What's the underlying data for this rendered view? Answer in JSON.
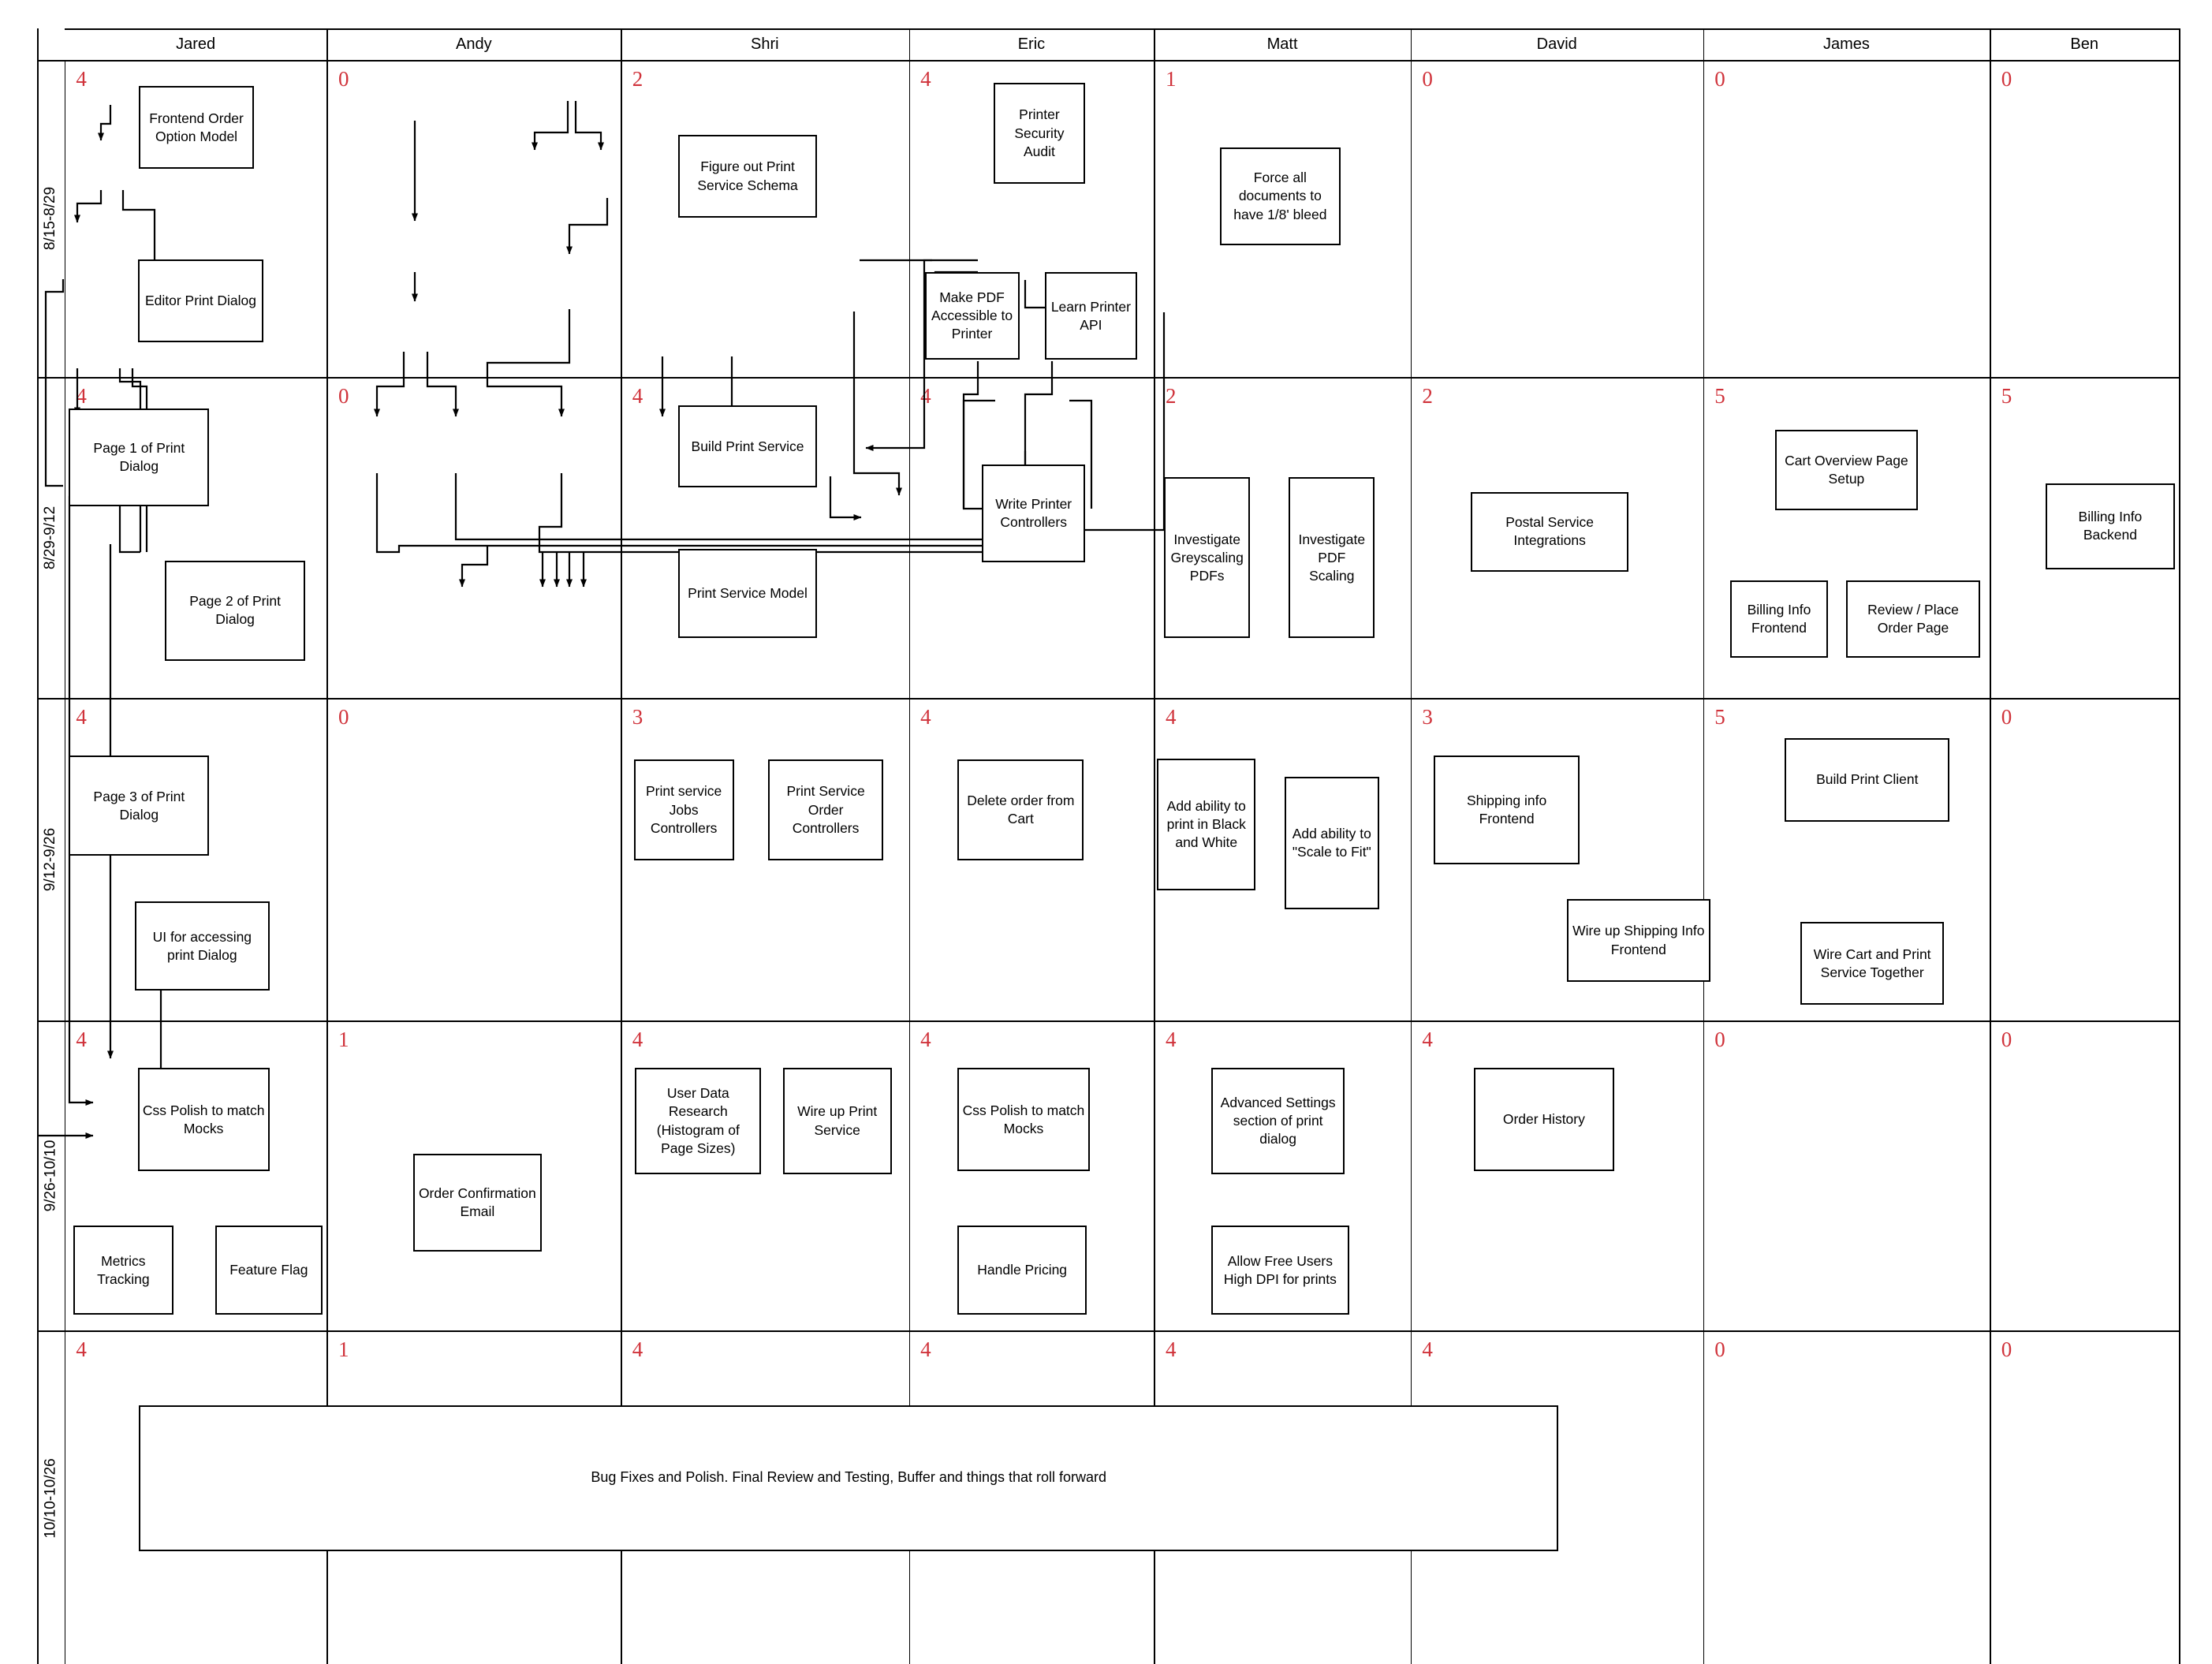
{
  "diagram": {
    "type": "sprint-swimlane-board",
    "columns": [
      {
        "name": "Jared"
      },
      {
        "name": "Andy"
      },
      {
        "name": "Shri"
      },
      {
        "name": "Eric"
      },
      {
        "name": "Matt"
      },
      {
        "name": "David"
      },
      {
        "name": "James"
      },
      {
        "name": "Ben"
      }
    ],
    "rows": [
      {
        "label": "8/15-8/29"
      },
      {
        "label": "8/29-9/12"
      },
      {
        "label": "9/12-9/26"
      },
      {
        "label": "9/26-10/10"
      },
      {
        "label": "10/10-10/26"
      }
    ],
    "counts": [
      [
        "4",
        "0",
        "2",
        "4",
        "1",
        "0",
        "0",
        "0"
      ],
      [
        "4",
        "0",
        "4",
        "4",
        "2",
        "2",
        "5",
        "5"
      ],
      [
        "4",
        "0",
        "3",
        "4",
        "4",
        "3",
        "5",
        "0"
      ],
      [
        "4",
        "1",
        "4",
        "4",
        "4",
        "4",
        "0",
        "0"
      ],
      [
        "4",
        "1",
        "4",
        "4",
        "4",
        "4",
        "0",
        "0"
      ]
    ],
    "count_color": "#d0333b",
    "nodes": [
      {
        "id": "frontend-order-option-model",
        "label": "Frontend Order Option Model"
      },
      {
        "id": "editor-print-dialog",
        "label": "Editor Print Dialog"
      },
      {
        "id": "figure-out-print-service-schema",
        "label": "Figure out Print Service Schema"
      },
      {
        "id": "printer-security-audit",
        "label": "Printer Security Audit"
      },
      {
        "id": "make-pdf-accessible-to-printer",
        "label": "Make PDF Accessible to Printer"
      },
      {
        "id": "learn-printer-api",
        "label": "Learn Printer API"
      },
      {
        "id": "force-all-documents-bleed",
        "label": "Force all documents to have 1/8' bleed"
      },
      {
        "id": "page-1-of-print-dialog",
        "label": "Page 1 of Print Dialog"
      },
      {
        "id": "page-2-of-print-dialog",
        "label": "Page 2 of Print Dialog"
      },
      {
        "id": "build-print-service",
        "label": "Build Print Service"
      },
      {
        "id": "print-service-model",
        "label": "Print Service Model"
      },
      {
        "id": "write-printer-controllers",
        "label": "Write Printer Controllers"
      },
      {
        "id": "investigate-greyscaling-pdfs",
        "label": "Investigate Greyscaling PDFs"
      },
      {
        "id": "investigate-pdf-scaling",
        "label": "Investigate PDF Scaling"
      },
      {
        "id": "postal-service-integrations",
        "label": "Postal Service Integrations"
      },
      {
        "id": "cart-overview-page-setup",
        "label": "Cart Overview Page Setup"
      },
      {
        "id": "billing-info-frontend",
        "label": "Billing Info Frontend"
      },
      {
        "id": "review-place-order-page",
        "label": "Review / Place Order Page"
      },
      {
        "id": "billing-info-backend",
        "label": "Billing Info Backend"
      },
      {
        "id": "page-3-of-print-dialog",
        "label": "Page 3 of Print Dialog"
      },
      {
        "id": "ui-for-accessing-print-dialog",
        "label": "UI for accessing print Dialog"
      },
      {
        "id": "print-service-jobs-controllers",
        "label": "Print service Jobs Controllers"
      },
      {
        "id": "print-service-order-controllers",
        "label": "Print Service Order Controllers"
      },
      {
        "id": "delete-order-from-cart",
        "label": "Delete order from Cart"
      },
      {
        "id": "add-ability-print-black-white",
        "label": "Add ability to print in Black and White"
      },
      {
        "id": "add-ability-scale-to-fit",
        "label": "Add ability to \"Scale to Fit\""
      },
      {
        "id": "shipping-info-frontend",
        "label": "Shipping info Frontend"
      },
      {
        "id": "wire-up-shipping-info-frontend",
        "label": "Wire up Shipping Info Frontend"
      },
      {
        "id": "build-print-client",
        "label": "Build Print Client"
      },
      {
        "id": "wire-cart-and-print-service-together",
        "label": "Wire Cart and Print Service Together"
      },
      {
        "id": "css-polish-to-match-mocks-jared",
        "label": "Css Polish to match Mocks"
      },
      {
        "id": "metrics-tracking",
        "label": "Metrics Tracking"
      },
      {
        "id": "feature-flag",
        "label": "Feature Flag"
      },
      {
        "id": "order-confirmation-email",
        "label": "Order Confirmation Email"
      },
      {
        "id": "user-data-research",
        "label": "User Data Research (Histogram of Page Sizes)"
      },
      {
        "id": "wire-up-print-service",
        "label": "Wire up Print Service"
      },
      {
        "id": "css-polish-to-match-mocks-eric",
        "label": "Css Polish to match Mocks"
      },
      {
        "id": "handle-pricing",
        "label": "Handle Pricing"
      },
      {
        "id": "advanced-settings-section",
        "label": "Advanced Settings section of print dialog"
      },
      {
        "id": "allow-free-users-high-dpi",
        "label": "Allow Free Users High DPI for prints"
      },
      {
        "id": "order-history",
        "label": "Order History"
      },
      {
        "id": "bug-fixes-and-polish",
        "label": "Bug Fixes and Polish. Final Review and Testing, Buffer and things that roll forward"
      }
    ]
  }
}
